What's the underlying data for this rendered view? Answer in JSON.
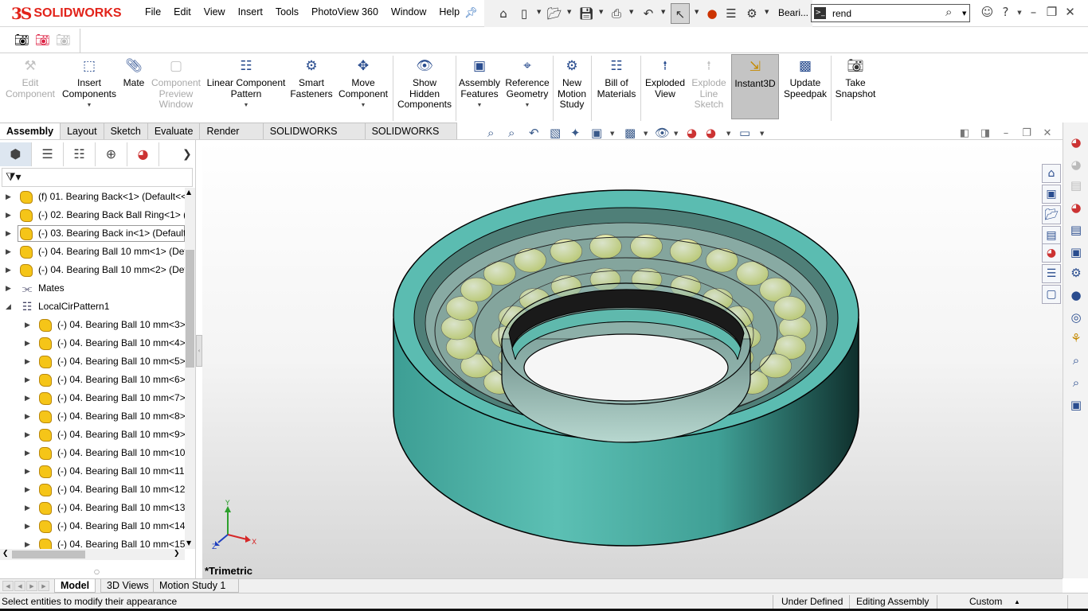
{
  "app": {
    "brand": "SOLIDWORKS",
    "brand_color": "#e2231a",
    "document_title": "Beari..."
  },
  "menu": [
    "File",
    "Edit",
    "View",
    "Insert",
    "Tools",
    "PhotoView 360",
    "Window",
    "Help"
  ],
  "search": {
    "value": "rend"
  },
  "commands": [
    {
      "label": "Edit\nComponent",
      "icon": "edit-component-icon",
      "enabled": false
    },
    {
      "label": "Insert\nComponents",
      "icon": "insert-components-icon",
      "enabled": true,
      "dropdown": true
    },
    {
      "label": "Mate",
      "icon": "mate-icon",
      "enabled": true
    },
    {
      "label": "Component\nPreview\nWindow",
      "icon": "component-preview-icon",
      "enabled": false
    },
    {
      "label": "Linear Component\nPattern",
      "icon": "linear-pattern-icon",
      "enabled": true,
      "dropdown": true
    },
    {
      "label": "Smart\nFasteners",
      "icon": "smart-fasteners-icon",
      "enabled": true
    },
    {
      "label": "Move\nComponent",
      "icon": "move-component-icon",
      "enabled": true,
      "dropdown": true
    },
    {
      "label": "Show\nHidden\nComponents",
      "icon": "show-hidden-icon",
      "enabled": true
    },
    {
      "label": "Assembly\nFeatures",
      "icon": "assembly-features-icon",
      "enabled": true,
      "dropdown": true
    },
    {
      "label": "Reference\nGeometry",
      "icon": "reference-geometry-icon",
      "enabled": true,
      "dropdown": true
    },
    {
      "label": "New\nMotion\nStudy",
      "icon": "motion-study-icon",
      "enabled": true
    },
    {
      "label": "Bill of\nMaterials",
      "icon": "bill-of-materials-icon",
      "enabled": true
    },
    {
      "label": "Exploded\nView",
      "icon": "exploded-view-icon",
      "enabled": true
    },
    {
      "label": "Explode\nLine\nSketch",
      "icon": "explode-line-sketch-icon",
      "enabled": false
    },
    {
      "label": "Instant3D",
      "icon": "instant3d-icon",
      "enabled": true,
      "active": true
    },
    {
      "label": "Update\nSpeedpak",
      "icon": "speedpak-icon",
      "enabled": true
    },
    {
      "label": "Take\nSnapshot",
      "icon": "camera-icon",
      "enabled": true
    }
  ],
  "tabs": [
    {
      "label": "Assembly",
      "active": true
    },
    {
      "label": "Layout"
    },
    {
      "label": "Sketch"
    },
    {
      "label": "Evaluate"
    },
    {
      "label": "Render Tools"
    },
    {
      "label": "SOLIDWORKS Add-Ins"
    },
    {
      "label": "SOLIDWORKS MBD"
    }
  ],
  "tree": [
    {
      "label": "(f) 01. Bearing Back<1> (Default<<",
      "level": 0,
      "type": "part"
    },
    {
      "label": "(-) 02. Bearing Back Ball Ring<1> (I",
      "level": 0,
      "type": "part"
    },
    {
      "label": "(-) 03. Bearing Back in<1> (Default",
      "level": 0,
      "type": "part",
      "selected": true
    },
    {
      "label": "(-) 04. Bearing Ball 10 mm<1> (Def",
      "level": 0,
      "type": "part"
    },
    {
      "label": "(-) 04. Bearing Ball 10 mm<2> (Def",
      "level": 0,
      "type": "part"
    },
    {
      "label": "Mates",
      "level": 0,
      "type": "mates"
    },
    {
      "label": "LocalCirPattern1",
      "level": 0,
      "type": "pattern",
      "expanded": true
    },
    {
      "label": "(-) 04. Bearing Ball 10 mm<3>",
      "level": 1,
      "type": "part"
    },
    {
      "label": "(-) 04. Bearing Ball 10 mm<4>",
      "level": 1,
      "type": "part"
    },
    {
      "label": "(-) 04. Bearing Ball 10 mm<5>",
      "level": 1,
      "type": "part"
    },
    {
      "label": "(-) 04. Bearing Ball 10 mm<6>",
      "level": 1,
      "type": "part"
    },
    {
      "label": "(-) 04. Bearing Ball 10 mm<7>",
      "level": 1,
      "type": "part"
    },
    {
      "label": "(-) 04. Bearing Ball 10 mm<8>",
      "level": 1,
      "type": "part"
    },
    {
      "label": "(-) 04. Bearing Ball 10 mm<9>",
      "level": 1,
      "type": "part"
    },
    {
      "label": "(-) 04. Bearing Ball 10 mm<10:",
      "level": 1,
      "type": "part"
    },
    {
      "label": "(-) 04. Bearing Ball 10 mm<11:",
      "level": 1,
      "type": "part"
    },
    {
      "label": "(-) 04. Bearing Ball 10 mm<12:",
      "level": 1,
      "type": "part"
    },
    {
      "label": "(-) 04. Bearing Ball 10 mm<13:",
      "level": 1,
      "type": "part"
    },
    {
      "label": "(-) 04. Bearing Ball 10 mm<14:",
      "level": 1,
      "type": "part"
    },
    {
      "label": "(-) 04. Bearing Ball 10 mm<15:",
      "level": 1,
      "type": "part"
    }
  ],
  "viewport": {
    "view_name": "*Trimetric",
    "model_color": "#5bbcb1",
    "ball_color": "#e8efa0",
    "triad": {
      "x": "X",
      "y": "Y",
      "z": "Z"
    }
  },
  "bottom_tabs": [
    {
      "label": "Model",
      "active": true
    },
    {
      "label": "3D Views"
    },
    {
      "label": "Motion Study 1"
    }
  ],
  "status": {
    "message": "Select entities to modify their appearance",
    "state": "Under Defined",
    "mode": "Editing Assembly",
    "units": "Custom"
  }
}
